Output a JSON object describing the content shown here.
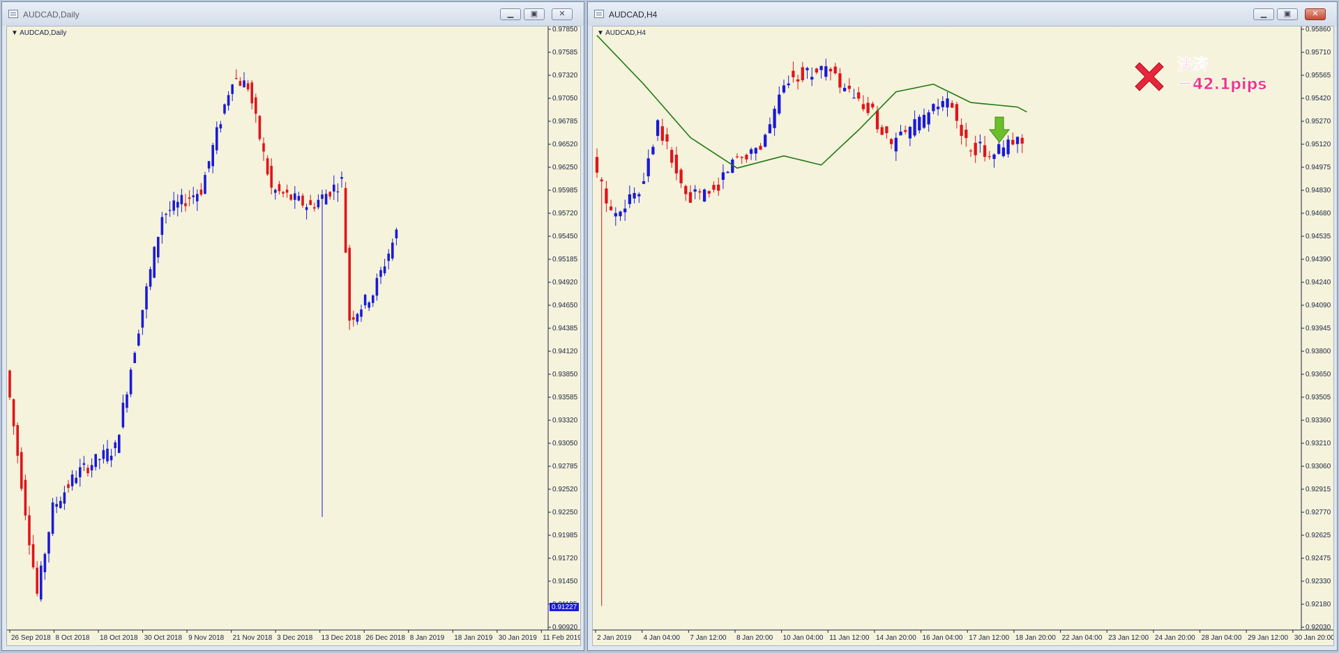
{
  "colors": {
    "background": "#f5f3dc",
    "bull_candle": "#1a1ad6",
    "bear_candle": "#e0141a",
    "moving_average": "#1f7a14",
    "price_marker_bg": "#1a1ad6",
    "settle_text": "#f0318a"
  },
  "left_window": {
    "title": "AUDCAD,Daily",
    "chart_label": "AUDCAD,Daily",
    "price_marker": "0.91227",
    "controls": [
      "minimize-icon",
      "maximize-icon",
      "close-icon"
    ]
  },
  "right_window": {
    "title": "AUDCAD,H4",
    "chart_label": "AUDCAD,H4",
    "annotation_line1": "決済",
    "annotation_line2": "ー42.1pips",
    "icons": [
      "red-x-icon",
      "green-down-arrow-icon"
    ],
    "controls": [
      "minimize-icon",
      "maximize-icon",
      "close-icon"
    ]
  },
  "chart_data": [
    {
      "type": "candlestick",
      "symbol": "AUDCAD",
      "timeframe": "Daily",
      "ylim": [
        0.9092,
        0.97858
      ],
      "y_ticks": [
        "0.97850",
        "0.97585",
        "0.97320",
        "0.97050",
        "0.96785",
        "0.96520",
        "0.96250",
        "0.95985",
        "0.95720",
        "0.95450",
        "0.95185",
        "0.94920",
        "0.94650",
        "0.94385",
        "0.94120",
        "0.93850",
        "0.93585",
        "0.93320",
        "0.93050",
        "0.92785",
        "0.92520",
        "0.92250",
        "0.91985",
        "0.91720",
        "0.91450",
        "0.91185",
        "0.90920"
      ],
      "x_ticks": [
        "26 Sep 2018",
        "8 Oct 2018",
        "18 Oct 2018",
        "30 Oct 2018",
        "9 Nov 2018",
        "21 Nov 2018",
        "3 Dec 2018",
        "13 Dec 2018",
        "26 Dec 2018",
        "8 Jan 2019",
        "18 Jan 2019",
        "30 Jan 2019",
        "11 Feb 2019"
      ],
      "bars": 100,
      "trend_points": [
        [
          0,
          0.939
        ],
        [
          8,
          0.913
        ],
        [
          12,
          0.923
        ],
        [
          18,
          0.927
        ],
        [
          28,
          0.93
        ],
        [
          34,
          0.944
        ],
        [
          40,
          0.957
        ],
        [
          50,
          0.96
        ],
        [
          58,
          0.973
        ],
        [
          62,
          0.972
        ],
        [
          68,
          0.96
        ],
        [
          78,
          0.958
        ],
        [
          86,
          0.961
        ],
        [
          88,
          0.945
        ],
        [
          94,
          0.948
        ],
        [
          100,
          0.955
        ],
        [
          110,
          0.95
        ],
        [
          115,
          0.949
        ]
      ]
    },
    {
      "type": "candlestick",
      "symbol": "AUDCAD",
      "timeframe": "H4",
      "ylim": [
        0.9194,
        0.9586
      ],
      "y_ticks": [
        "0.95860",
        "0.95710",
        "0.95565",
        "0.95420",
        "0.95270",
        "0.95120",
        "0.94975",
        "0.94830",
        "0.94680",
        "0.94535",
        "0.94390",
        "0.94240",
        "0.94090",
        "0.93945",
        "0.93800",
        "0.93650",
        "0.93505",
        "0.93360",
        "0.93210",
        "0.93060",
        "0.92915",
        "0.92770",
        "0.92625",
        "0.92475",
        "0.92330",
        "0.92180",
        "0.92030"
      ],
      "x_ticks": [
        "2 Jan 2019",
        "4 Jan 04:00",
        "7 Jan 12:00",
        "8 Jan 20:00",
        "10 Jan 04:00",
        "11 Jan 12:00",
        "14 Jan 20:00",
        "16 Jan 04:00",
        "17 Jan 12:00",
        "18 Jan 20:00",
        "22 Jan 04:00",
        "23 Jan 12:00",
        "24 Jan 20:00",
        "28 Jan 04:00",
        "29 Jan 12:00",
        "30 Jan 20:00"
      ],
      "bars": 100,
      "trend_points": [
        [
          0,
          0.95
        ],
        [
          4,
          0.9465
        ],
        [
          10,
          0.948
        ],
        [
          14,
          0.9525
        ],
        [
          20,
          0.9475
        ],
        [
          26,
          0.948
        ],
        [
          30,
          0.95
        ],
        [
          36,
          0.951
        ],
        [
          42,
          0.9555
        ],
        [
          50,
          0.956
        ],
        [
          56,
          0.954
        ],
        [
          60,
          0.953
        ],
        [
          64,
          0.951
        ],
        [
          70,
          0.9525
        ],
        [
          76,
          0.954
        ],
        [
          80,
          0.951
        ],
        [
          86,
          0.9505
        ],
        [
          92,
          0.9515
        ],
        [
          96,
          0.95
        ],
        [
          100,
          0.953
        ],
        [
          104,
          0.9545
        ],
        [
          108,
          0.949
        ],
        [
          110,
          0.9485
        ]
      ],
      "moving_average": [
        [
          0,
          0.9582
        ],
        [
          10,
          0.955
        ],
        [
          20,
          0.9515
        ],
        [
          30,
          0.9495
        ],
        [
          40,
          0.9503
        ],
        [
          48,
          0.9497
        ],
        [
          56,
          0.952
        ],
        [
          64,
          0.9545
        ],
        [
          72,
          0.955
        ],
        [
          80,
          0.9538
        ],
        [
          90,
          0.9535
        ],
        [
          98,
          0.9522
        ],
        [
          104,
          0.9515
        ],
        [
          110,
          0.9512
        ]
      ]
    }
  ]
}
